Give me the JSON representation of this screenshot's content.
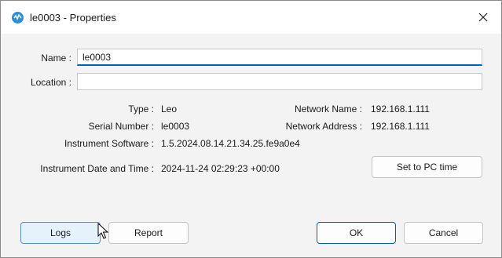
{
  "window": {
    "title": "le0003 - Properties",
    "app_icon": "instrument-app-icon",
    "close_icon": "close-icon"
  },
  "form": {
    "name_label": "Name :",
    "name_value": "le0003",
    "location_label": "Location :",
    "location_value": ""
  },
  "info": {
    "type_label": "Type :",
    "type_value": "Leo",
    "serial_label": "Serial Number :",
    "serial_value": "le0003",
    "software_label": "Instrument Software :",
    "software_value": "1.5.2024.08.14.21.34.25.fe9a0e4",
    "network_name_label": "Network Name :",
    "network_name_value": "192.168.1.111",
    "network_address_label": "Network Address :",
    "network_address_value": "192.168.1.111",
    "datetime_label": "Instrument Date and Time :",
    "datetime_value": "2024-11-24 02:29:23 +00:00"
  },
  "buttons": {
    "set_pc_time": "Set to PC time",
    "logs": "Logs",
    "report": "Report",
    "ok": "OK",
    "cancel": "Cancel"
  },
  "colors": {
    "accent": "#005fb8",
    "hover_fill": "#e5f1fb",
    "dialog_bg": "#f3f3f3"
  }
}
